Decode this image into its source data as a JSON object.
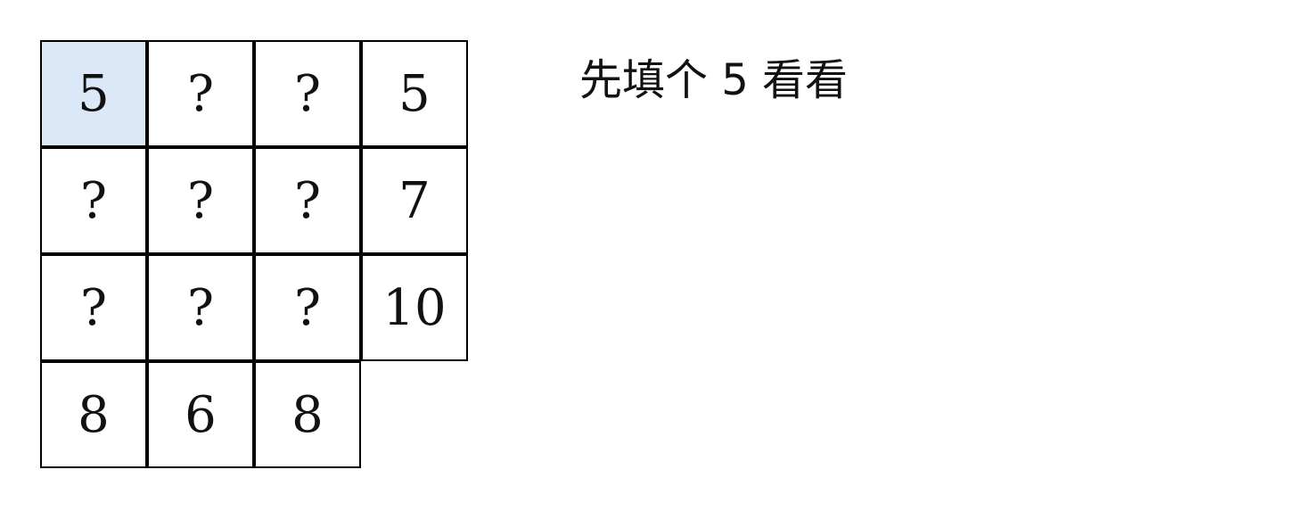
{
  "grid": {
    "rows": [
      [
        "5",
        "?",
        "?",
        "5"
      ],
      [
        "?",
        "?",
        "?",
        "7"
      ],
      [
        "?",
        "?",
        "?",
        "10"
      ],
      [
        "8",
        "6",
        "8",
        ""
      ]
    ],
    "highlighted_cell": {
      "row": 0,
      "col": 0
    },
    "highlight_color": "#dbe8f8",
    "cell_color": "#ffffff",
    "border_color": "#000000"
  },
  "caption": "先填个 5 看看"
}
